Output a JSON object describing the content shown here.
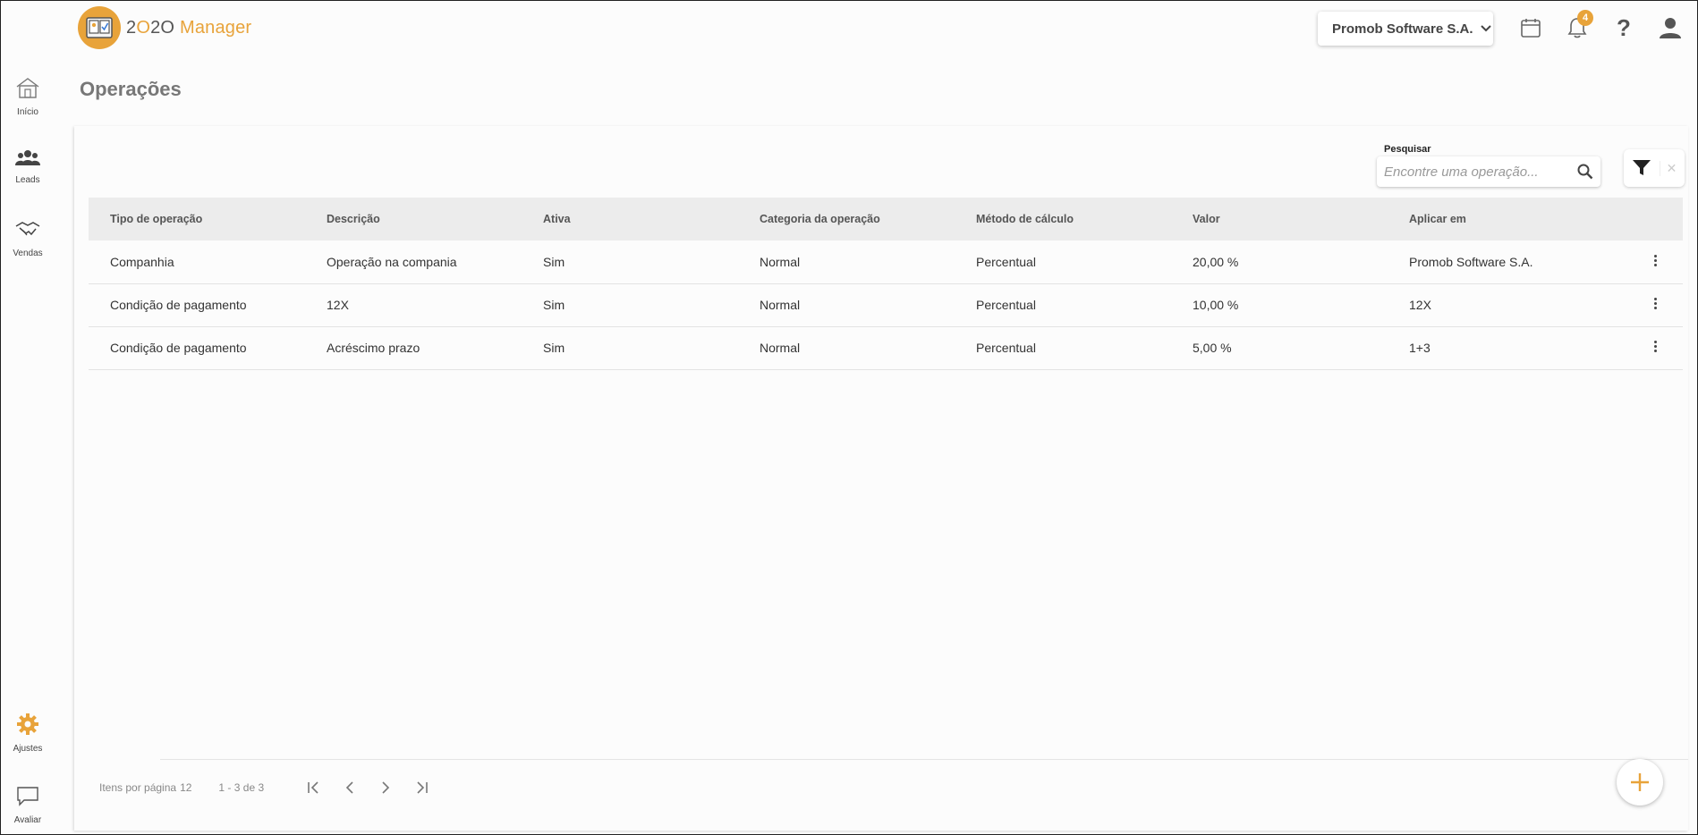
{
  "app": {
    "logo_prefix": "2",
    "logo_o": "O",
    "logo_mid": "2O",
    "logo_suffix": "Manager",
    "accent_color": "#e8a33a"
  },
  "header": {
    "company": "Promob Software S.A.",
    "notifications_count": "4",
    "help": "?"
  },
  "sidebar": {
    "items": [
      {
        "label": "Início",
        "icon": "home-icon"
      },
      {
        "label": "Leads",
        "icon": "people-icon"
      },
      {
        "label": "Vendas",
        "icon": "handshake-icon"
      },
      {
        "label": "Ajustes",
        "icon": "gear-icon"
      },
      {
        "label": "Avaliar",
        "icon": "chat-icon"
      }
    ]
  },
  "page": {
    "title": "Operações"
  },
  "search": {
    "label": "Pesquisar",
    "placeholder": "Encontre uma operação..."
  },
  "filter": {
    "clear": "✕"
  },
  "table": {
    "columns": [
      "Tipo de operação",
      "Descrição",
      "Ativa",
      "Categoria da operação",
      "Método de cálculo",
      "Valor",
      "Aplicar em"
    ],
    "rows": [
      [
        "Companhia",
        "Operação na compania",
        "Sim",
        "Normal",
        "Percentual",
        "20,00 %",
        "Promob Software S.A."
      ],
      [
        "Condição de pagamento",
        "12X",
        "Sim",
        "Normal",
        "Percentual",
        "10,00 %",
        "12X"
      ],
      [
        "Condição de pagamento",
        "Acréscimo prazo",
        "Sim",
        "Normal",
        "Percentual",
        "5,00 %",
        "1+3"
      ]
    ]
  },
  "pagination": {
    "items_per_page_label": "Itens por página",
    "items_per_page": "12",
    "range": "1 - 3 de 3"
  }
}
